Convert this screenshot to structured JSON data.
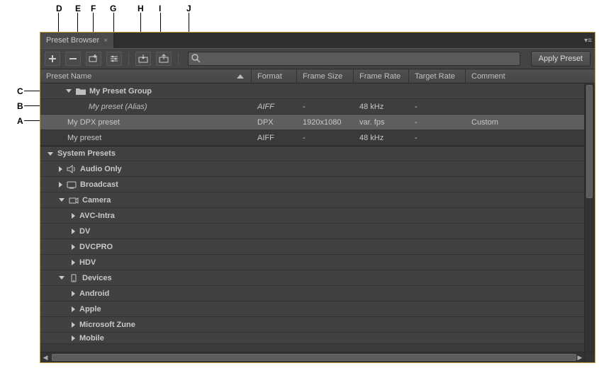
{
  "callouts": {
    "A": "A",
    "B": "B",
    "C": "C",
    "D": "D",
    "E": "E",
    "F": "F",
    "G": "G",
    "H": "H",
    "I": "I",
    "J": "J"
  },
  "panel": {
    "tab_title": "Preset Browser",
    "apply_button": "Apply Preset",
    "search_placeholder": ""
  },
  "columns": {
    "name": "Preset Name",
    "format": "Format",
    "frame_size": "Frame Size",
    "frame_rate": "Frame Rate",
    "target_rate": "Target Rate",
    "comment": "Comment"
  },
  "rows": {
    "user_group": "My Preset Group",
    "alias": {
      "name": "My preset (Alias)",
      "format": "AIFF",
      "frame_size": "-",
      "frame_rate": "48 kHz",
      "target_rate": "-",
      "comment": ""
    },
    "dpx": {
      "name": "My DPX preset",
      "format": "DPX",
      "frame_size": "1920x1080",
      "frame_rate": "var. fps",
      "target_rate": "-",
      "comment": "Custom"
    },
    "mypreset": {
      "name": "My preset",
      "format": "AIFF",
      "frame_size": "-",
      "frame_rate": "48 kHz",
      "target_rate": "-",
      "comment": ""
    },
    "system_presets": "System Presets",
    "audio_only": "Audio Only",
    "broadcast": "Broadcast",
    "camera": "Camera",
    "avc_intra": "AVC-Intra",
    "dv": "DV",
    "dvcpro": "DVCPRO",
    "hdv": "HDV",
    "devices": "Devices",
    "android": "Android",
    "apple": "Apple",
    "zune": "Microsoft Zune",
    "mobile": "Mobile"
  }
}
